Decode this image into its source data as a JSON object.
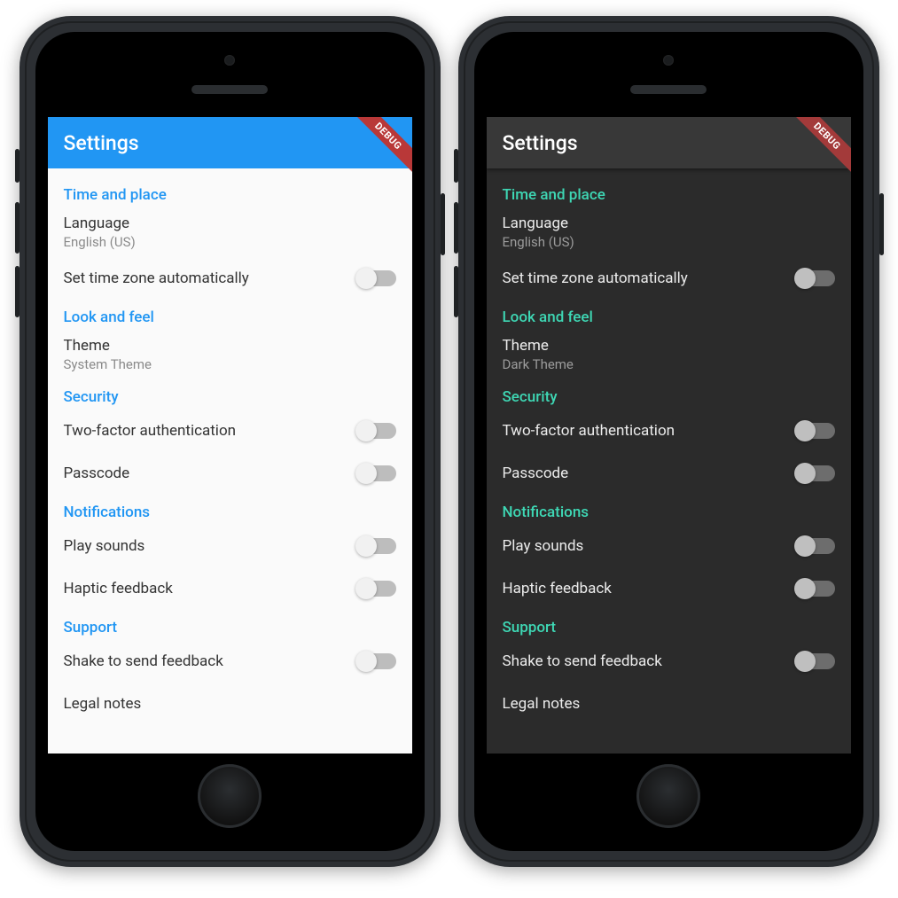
{
  "debug_label": "DEBUG",
  "appbar_title": "Settings",
  "sections": {
    "time": {
      "title": "Time and place",
      "language_label": "Language",
      "language_value": "English (US)",
      "timezone_label": "Set time zone automatically"
    },
    "look": {
      "title": "Look and feel",
      "theme_label": "Theme",
      "theme_value_light": "System Theme",
      "theme_value_dark": "Dark Theme"
    },
    "security": {
      "title": "Security",
      "twofa_label": "Two-factor authentication",
      "passcode_label": "Passcode"
    },
    "notifications": {
      "title": "Notifications",
      "sounds_label": "Play sounds",
      "haptic_label": "Haptic feedback"
    },
    "support": {
      "title": "Support",
      "shake_label": "Shake to send feedback",
      "legal_label": "Legal notes"
    }
  },
  "toggles": {
    "timezone_auto": false,
    "twofa": false,
    "passcode": false,
    "play_sounds": false,
    "haptic": false,
    "shake_feedback": false
  },
  "colors": {
    "light_accent": "#2196f3",
    "dark_accent": "#3ed7b4",
    "debug_ribbon": "#b93838"
  }
}
